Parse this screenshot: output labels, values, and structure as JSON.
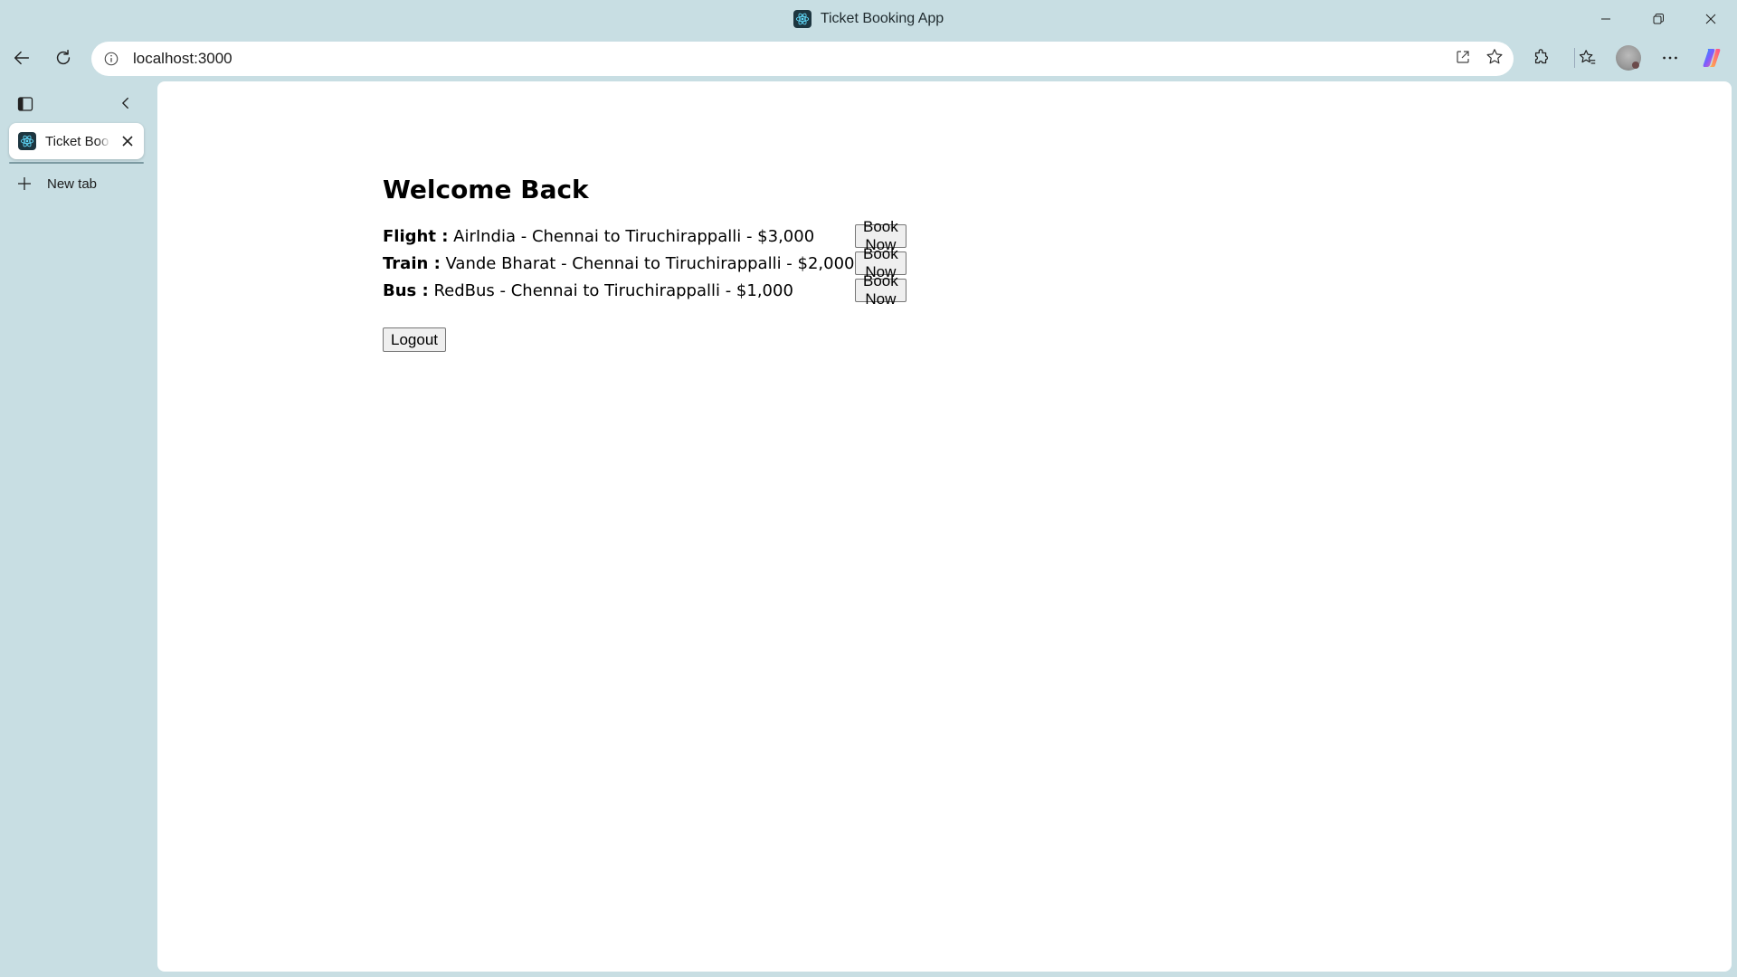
{
  "window": {
    "title": "Ticket Booking App"
  },
  "browser": {
    "url": "localhost:3000"
  },
  "tabs": [
    {
      "label": "Ticket Booking App",
      "display": "Ticket Boo"
    }
  ],
  "sidebar": {
    "new_tab_label": "New tab"
  },
  "page": {
    "heading": "Welcome Back",
    "bookings": [
      {
        "mode": "Flight :",
        "details": " AirIndia - Chennai to Tiruchirappalli - $3,000",
        "button": "Book Now"
      },
      {
        "mode": "Train :",
        "details": " Vande Bharat - Chennai to Tiruchirappalli - $2,000",
        "button": "Book Now"
      },
      {
        "mode": "Bus :",
        "details": " RedBus - Chennai to Tiruchirappalli - $1,000",
        "button": "Book Now"
      }
    ],
    "logout_label": "Logout"
  },
  "colors": {
    "chrome_bg": "#c8dee3",
    "page_bg": "#ffffff",
    "button_bg": "#efefef",
    "button_border": "#767676"
  },
  "icons": {
    "app": "react-logo-icon",
    "minimize": "minimize-icon",
    "restore": "restore-icon",
    "close": "close-icon",
    "back": "back-arrow-icon",
    "reload": "reload-icon",
    "site_info": "info-icon",
    "open_in_app": "open-external-icon",
    "favorite": "star-icon",
    "extensions": "puzzle-icon",
    "favorites": "favorites-icon",
    "profile": "avatar",
    "more": "more-icon",
    "copilot": "copilot-icon",
    "sidebar_toggle": "tab-actions-icon",
    "collapse": "chevron-left-icon",
    "new_tab": "plus-icon"
  }
}
